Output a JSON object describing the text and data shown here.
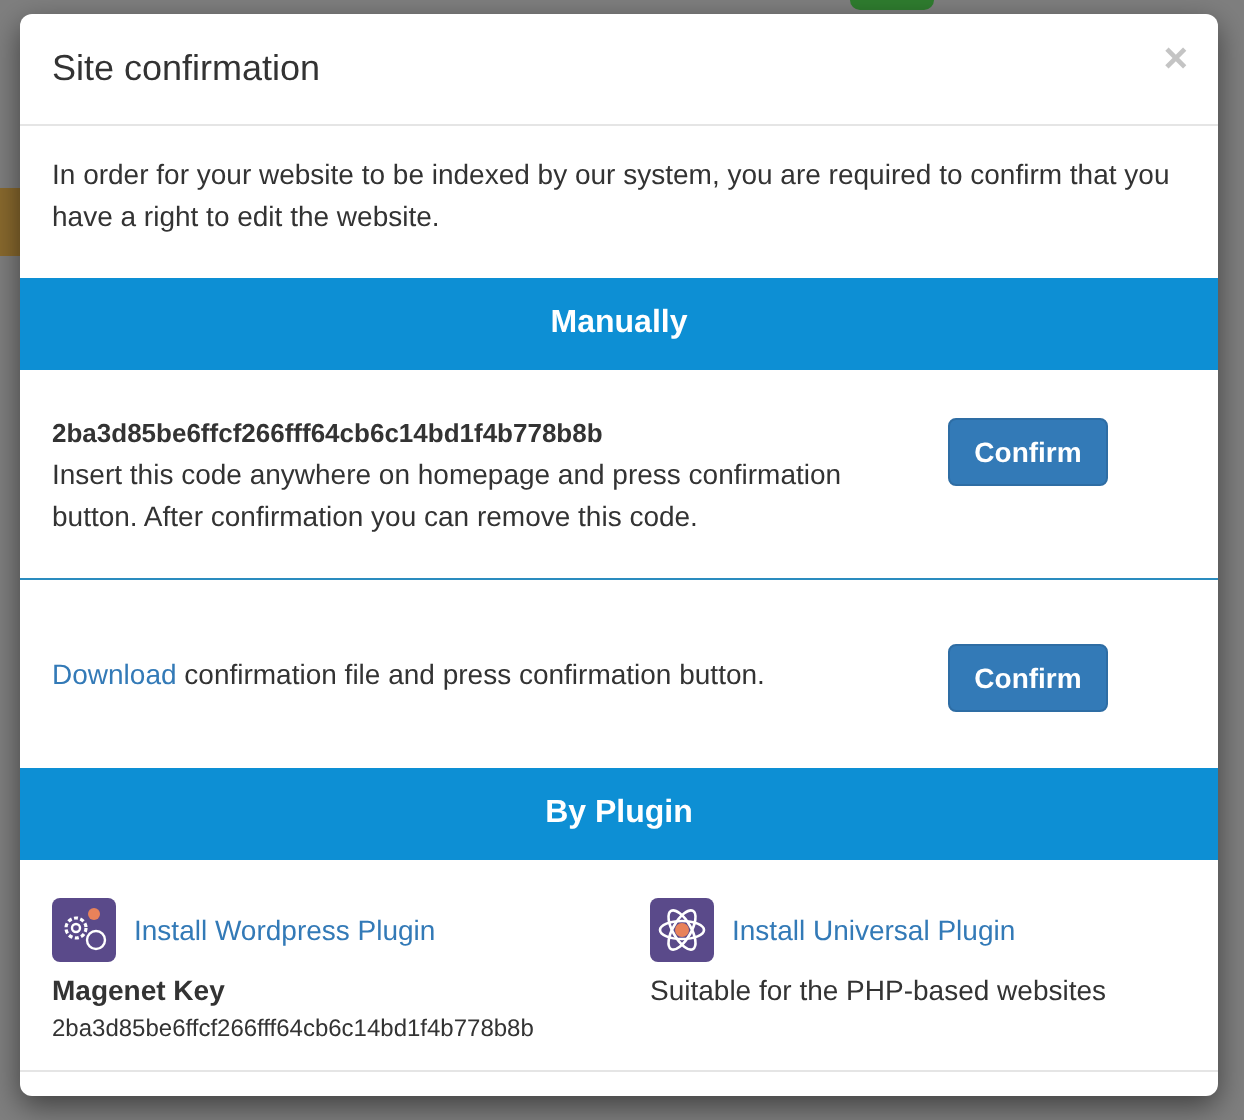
{
  "modal": {
    "title": "Site confirmation",
    "close": "×",
    "intro": "In order for your website to be indexed by our system, you are required to confirm that you have a right to edit the website.",
    "sections": [
      {
        "heading": "Manually",
        "methods": [
          {
            "kind": "code",
            "code": "2ba3d85be6ffcf266fff64cb6c14bd1f4b778b8b",
            "text": "Insert this code anywhere on homepage and press confirmation button. After confirmation you can remove this code.",
            "button": "Confirm"
          },
          {
            "kind": "file",
            "link": "Download",
            "text": "confirmation file and press confirmation button.",
            "button": "Confirm"
          }
        ]
      },
      {
        "heading": "By Plugin",
        "plugins": [
          {
            "kind": "wordpress",
            "link": "Install Wordpress Plugin",
            "label": "Magenet Key",
            "detail": "2ba3d85be6ffcf266fff64cb6c14bd1f4b778b8b"
          },
          {
            "kind": "universal",
            "link": "Install Universal Plugin",
            "detail": "Suitable for the PHP-based websites"
          }
        ]
      }
    ]
  }
}
